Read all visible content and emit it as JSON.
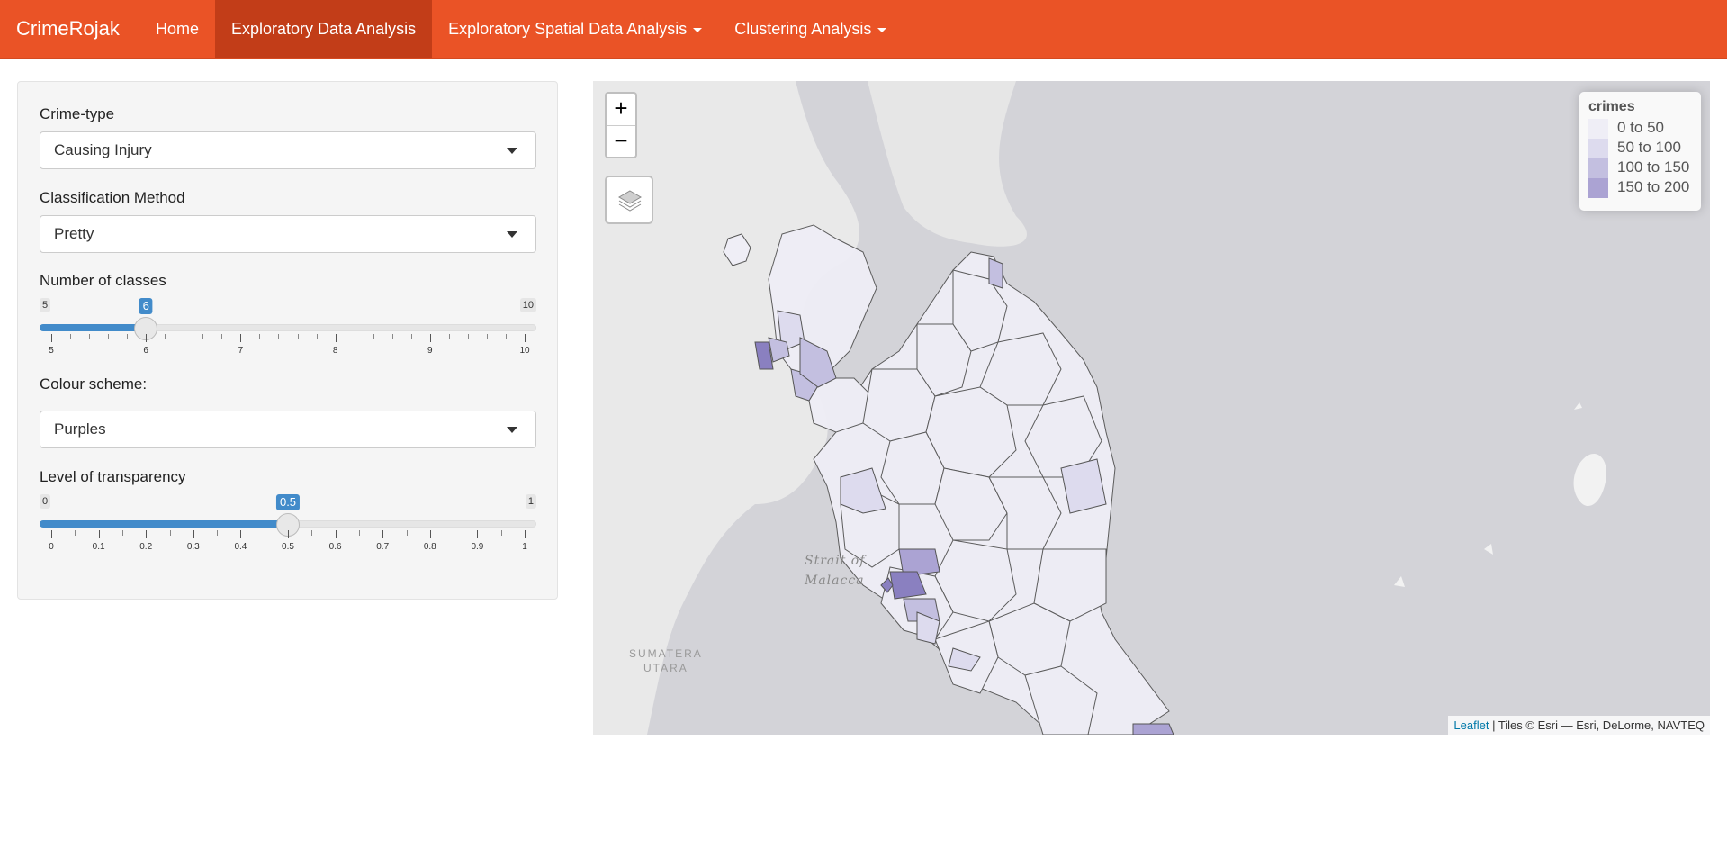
{
  "navbar": {
    "brand": "CrimeRojak",
    "items": [
      {
        "label": "Home",
        "active": false,
        "dropdown": false
      },
      {
        "label": "Exploratory Data Analysis",
        "active": true,
        "dropdown": false
      },
      {
        "label": "Exploratory Spatial Data Analysis",
        "active": false,
        "dropdown": true
      },
      {
        "label": "Clustering Analysis",
        "active": false,
        "dropdown": true
      }
    ]
  },
  "sidebar": {
    "crime_type": {
      "label": "Crime-type",
      "value": "Causing Injury"
    },
    "classification": {
      "label": "Classification Method",
      "value": "Pretty"
    },
    "num_classes": {
      "label": "Number of classes",
      "min": 5,
      "max": 10,
      "value": 6,
      "min_label": "5",
      "max_label": "10",
      "value_label": "6",
      "tick_labels": [
        "5",
        "6",
        "7",
        "8",
        "9",
        "10"
      ]
    },
    "colour_scheme": {
      "label": "Colour scheme:",
      "value": "Purples"
    },
    "transparency": {
      "label": "Level of transparency",
      "min": 0,
      "max": 1,
      "value": 0.5,
      "min_label": "0",
      "max_label": "1",
      "value_label": "0.5",
      "tick_labels": [
        "0",
        "0.1",
        "0.2",
        "0.3",
        "0.4",
        "0.5",
        "0.6",
        "0.7",
        "0.8",
        "0.9",
        "1"
      ]
    }
  },
  "map": {
    "zoom_in": "+",
    "zoom_out": "−",
    "sea_label": "Strait of\nMalacca",
    "land_label": "SUMATERA\nUTARA",
    "legend": {
      "title": "crimes",
      "items": [
        {
          "label": "0 to 50",
          "color": "#efeef6"
        },
        {
          "label": "50 to 100",
          "color": "#dddbee"
        },
        {
          "label": "100 to 150",
          "color": "#c3bfe0"
        },
        {
          "label": "150 to 200",
          "color": "#aba3d3"
        }
      ]
    },
    "attribution": {
      "link": "Leaflet",
      "text": " | Tiles © Esri — Esri, DeLorme, NAVTEQ"
    }
  }
}
